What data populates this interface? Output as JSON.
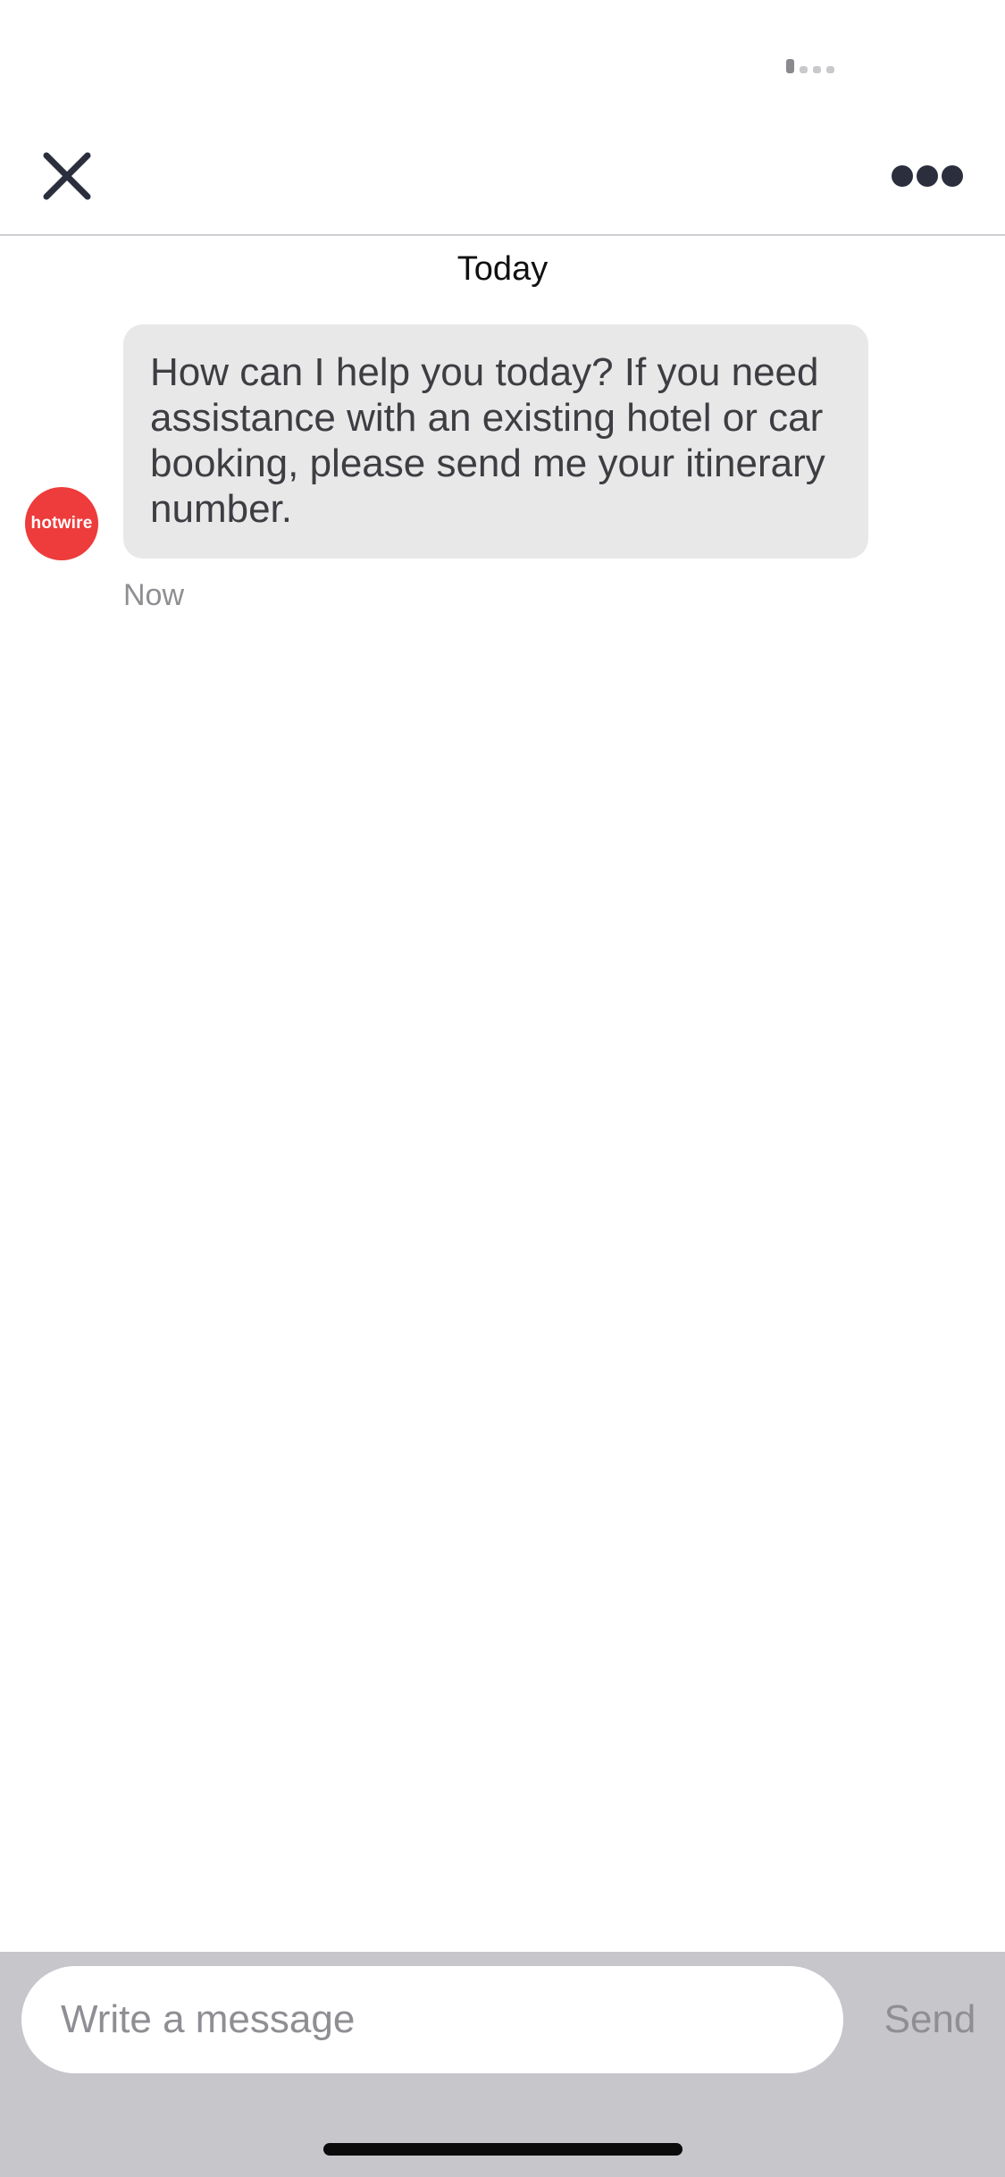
{
  "header": {
    "close_icon": "close-icon",
    "more_icon": "more-horizontal-icon"
  },
  "chat": {
    "date_divider": "Today",
    "messages": [
      {
        "sender_logo": "hotwire",
        "text": "How can I help you today? If you need assistance with an existing hotel or car booking, please send me your itinerary number.",
        "time": "Now"
      }
    ]
  },
  "composer": {
    "placeholder": "Write a message",
    "value": "",
    "send_label": "Send"
  },
  "colors": {
    "brand": "#ee3b3b",
    "bubble": "#e8e8e9",
    "composer_bg": "#c6c6cb",
    "icon_dark": "#2b2f3d"
  }
}
